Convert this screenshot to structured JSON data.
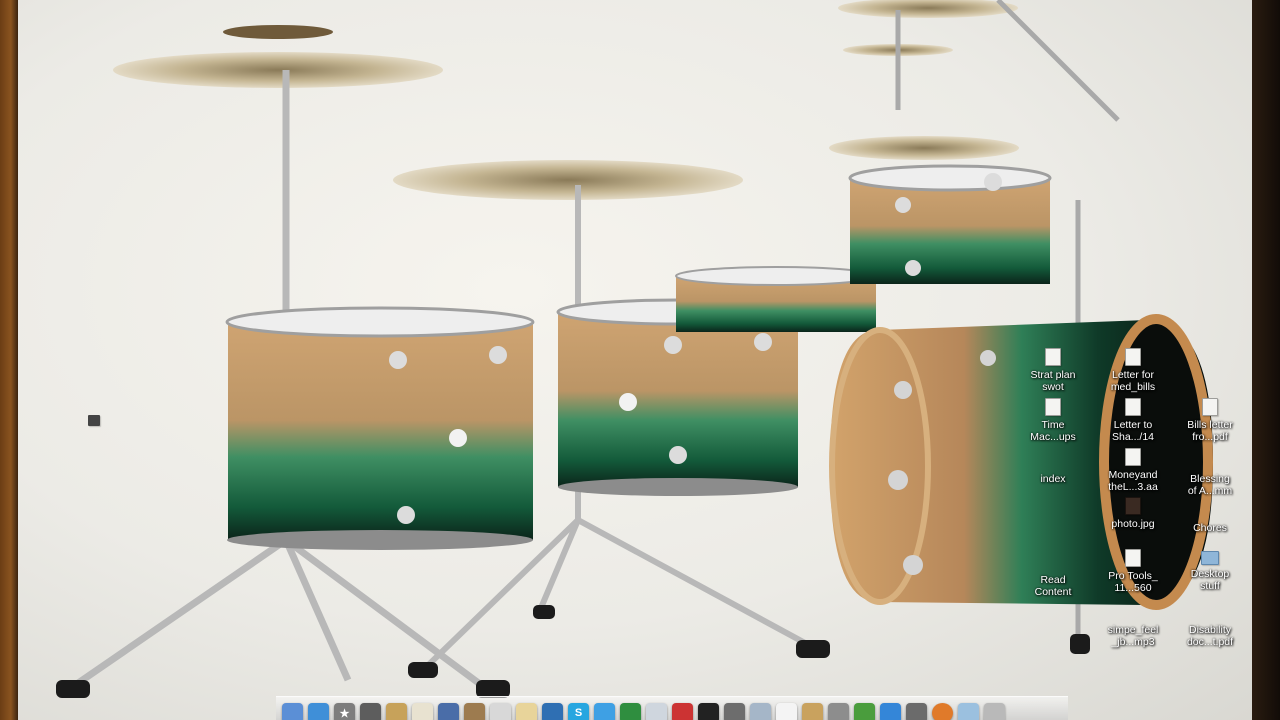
{
  "desktop_icons": [
    {
      "label": "Strat plan\nswot",
      "kind": "doc"
    },
    {
      "label": "Letter for\nmed_bills",
      "kind": "doc"
    },
    {
      "label": "Time\nMac...ups",
      "kind": "doc"
    },
    {
      "label": "Letter to\nSha.../14",
      "kind": "doc"
    },
    {
      "label": "Bills letter\nfro...pdf",
      "kind": "doc"
    },
    {
      "label": "index",
      "kind": "doc"
    },
    {
      "label": "Moneyand\ntheL...3.aa",
      "kind": "doc"
    },
    {
      "label": "Blessing\nof A...mm",
      "kind": "doc"
    },
    {
      "label": "photo.jpg",
      "kind": "dark"
    },
    {
      "label": "Chores",
      "kind": "doc"
    },
    {
      "label": "Read\nContent",
      "kind": "doc"
    },
    {
      "label": "Pro Tools_\n11...560",
      "kind": "doc"
    },
    {
      "label": "Desktop\nstuff",
      "kind": "folder"
    },
    {
      "label": "simpe_feel\n_jb...mp3",
      "kind": "doc"
    },
    {
      "label": "Disability\ndoc...t.pdf",
      "kind": "doc"
    }
  ],
  "dock": {
    "icons": [
      {
        "name": "finder-icon",
        "color": "#5b8fd6",
        "glyph": ""
      },
      {
        "name": "safari-icon",
        "color": "#3f8fd8",
        "glyph": ""
      },
      {
        "name": "launchpad-icon",
        "color": "#7d7d7d",
        "glyph": "★"
      },
      {
        "name": "system-prefs-icon",
        "color": "#5d5d5d",
        "glyph": ""
      },
      {
        "name": "guitar-icon",
        "color": "#c7a25a",
        "glyph": ""
      },
      {
        "name": "doc-icon",
        "color": "#e8e2d0",
        "glyph": ""
      },
      {
        "name": "grid-icon",
        "color": "#4a6da8",
        "glyph": ""
      },
      {
        "name": "photos-icon",
        "color": "#9d7b4f",
        "glyph": ""
      },
      {
        "name": "dashboard-icon",
        "color": "#d8d8d8",
        "glyph": ""
      },
      {
        "name": "notes-icon",
        "color": "#e8d49a",
        "glyph": ""
      },
      {
        "name": "app-icon-blue",
        "color": "#2f6fb3",
        "glyph": ""
      },
      {
        "name": "skype-icon",
        "color": "#27a6e0",
        "glyph": "S"
      },
      {
        "name": "appstore-icon",
        "color": "#3ea0e4",
        "glyph": ""
      },
      {
        "name": "facetime-icon",
        "color": "#2f8e3f",
        "glyph": ""
      },
      {
        "name": "mail-icon",
        "color": "#cfd6de",
        "glyph": ""
      },
      {
        "name": "acrobat-icon",
        "color": "#c33",
        "glyph": ""
      },
      {
        "name": "blackberry-icon",
        "color": "#222",
        "glyph": ""
      },
      {
        "name": "script-icon",
        "color": "#6d6d6d",
        "glyph": ""
      },
      {
        "name": "preview-icon",
        "color": "#a5b6c8",
        "glyph": ""
      },
      {
        "name": "calendar-icon",
        "color": "#f4f4f4",
        "glyph": ""
      },
      {
        "name": "contacts-icon",
        "color": "#c9a25e",
        "glyph": ""
      },
      {
        "name": "printer-icon",
        "color": "#8d8d8d",
        "glyph": ""
      },
      {
        "name": "phone-icon",
        "color": "#4a9d3d",
        "glyph": ""
      },
      {
        "name": "itunes-icon",
        "color": "#3486d8",
        "glyph": ""
      },
      {
        "name": "finder-2-icon",
        "color": "#6b6b6b",
        "glyph": ""
      },
      {
        "name": "firefox-icon",
        "color": "#e07a2a",
        "glyph": ""
      },
      {
        "name": "folder-icon",
        "color": "#9bc0df",
        "glyph": ""
      },
      {
        "name": "trash-icon",
        "color": "#b9b9b9",
        "glyph": ""
      }
    ]
  },
  "colors": {
    "label_text": "#ffffff",
    "drum_green": "#1f7a4f",
    "drum_wood": "#c79a62",
    "chrome": "#c9c9c9"
  }
}
